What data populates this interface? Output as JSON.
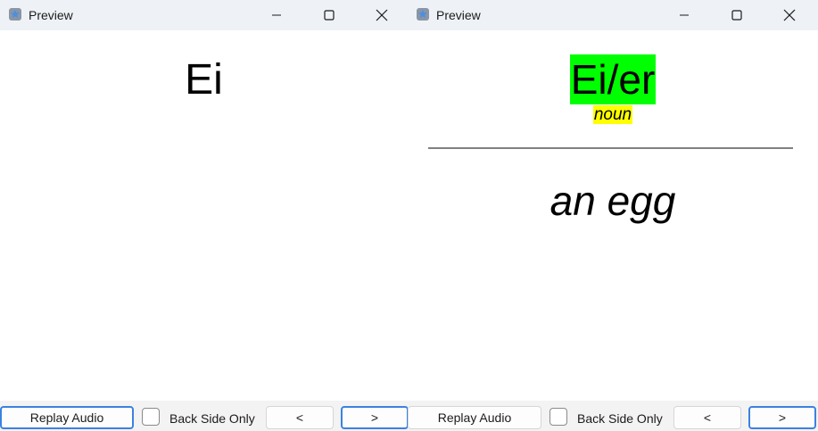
{
  "colors": {
    "titlebar_bg": "#eef2f6",
    "focus_border": "#3b82e0",
    "word_highlight": "#00ff00",
    "pos_highlight": "#ffff00",
    "divider": "#808080"
  },
  "windows": [
    {
      "title": "Preview",
      "card": {
        "front": "Ei"
      },
      "controls": {
        "replay": "Replay Audio",
        "back_only": "Back Side Only",
        "prev": "<",
        "next": ">"
      }
    },
    {
      "title": "Preview",
      "card": {
        "word": "Ei/er",
        "pos": "noun",
        "meaning": "an egg"
      },
      "controls": {
        "replay": "Replay Audio",
        "back_only": "Back Side Only",
        "prev": "<",
        "next": ">"
      }
    }
  ],
  "icons": {
    "app": "anki-star-icon",
    "minimize": "minimize-icon",
    "maximize": "maximize-icon",
    "close": "close-icon"
  }
}
